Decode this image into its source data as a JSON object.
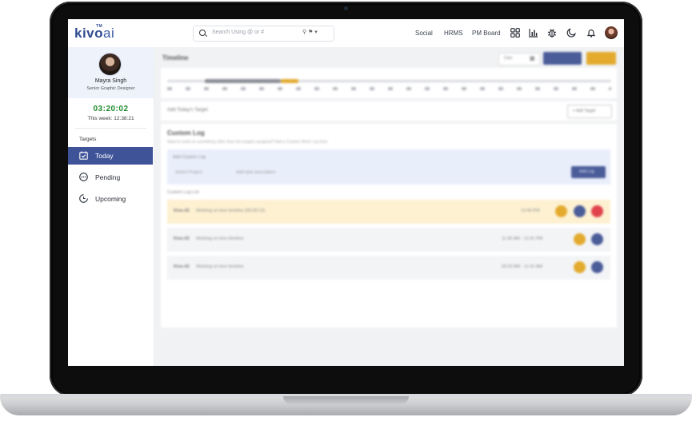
{
  "app": {
    "logo_main": "kivo",
    "logo_ai": "ai",
    "logo_tm": "TM"
  },
  "search": {
    "placeholder": "Search Using @ or #",
    "tools": "⚲ ⚑ ▾"
  },
  "nav": {
    "social": "Social",
    "hrms": "HRMS",
    "pm_board": "PM Board"
  },
  "user": {
    "name": "Mayra Singh",
    "role": "Senior Graphic Designer"
  },
  "timer": {
    "today": "03:20:02",
    "week": "This week: 12:38:21"
  },
  "sidebar": {
    "section_label": "Targets",
    "items": [
      {
        "label": "Today",
        "icon": "calendar-check-icon",
        "glyph": "🗓",
        "active": true
      },
      {
        "label": "Pending",
        "icon": "pending-dots-icon",
        "glyph": "⋯",
        "active": false
      },
      {
        "label": "Upcoming",
        "icon": "clock-icon",
        "glyph": "◔",
        "active": false
      }
    ]
  },
  "main": {
    "title": "Timeline",
    "date_select": "Date",
    "add_target_label": "Add Today's Target",
    "add_target_button": "+ Add Target",
    "custom_log_title": "Custom Log",
    "custom_log_subtitle": "Want to work on something other than the targets assigned? Add a Custom Work Log here",
    "add_custom_log_label": "Add Custom Log",
    "select_project": "Select Project",
    "task_placeholder": "Add task description",
    "add_log_button": "Add Log",
    "log_list_label": "Custom Log List",
    "logs": [
      {
        "code": "Kivo-02",
        "text": "Working on kivo timeline (00:09:13)",
        "time": "12:45 PM",
        "highlight": true
      },
      {
        "code": "Kivo-02",
        "text": "Working on kivo timeline",
        "time": "11:45 AM - 12:41 PM",
        "highlight": false
      },
      {
        "code": "Kivo-02",
        "text": "Working on kivo timeline",
        "time": "09:30 AM - 11:41 AM",
        "highlight": false
      }
    ]
  },
  "colors": {
    "accent": "#3f5498",
    "timer": "#1f8a2c",
    "yellow": "#e8b12c",
    "red": "#e0434b",
    "highlight_row": "#fdf1d2"
  }
}
